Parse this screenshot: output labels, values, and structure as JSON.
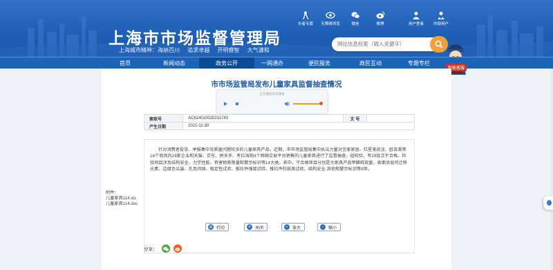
{
  "header": {
    "title": "上海市市场监督管理局",
    "spirit": [
      "上海城市精神：海纳百川",
      "追求卓越",
      "开明睿智",
      "大气谦和"
    ],
    "icons": [
      {
        "label": "长者专版",
        "icon": "elderly-icon"
      },
      {
        "label": "无障碍浏览",
        "icon": "accessibility-eye-icon"
      },
      {
        "label": "微信",
        "icon": "wechat-icon"
      },
      {
        "label": "微博",
        "icon": "weibo-icon"
      },
      {
        "label": "用户登录",
        "icon": "user-login-icon"
      },
      {
        "label": "内部用户",
        "icon": "internal-user-icon"
      }
    ],
    "search_placeholder": "网站信息检索（输入关键字）"
  },
  "nav": {
    "items": [
      "首页",
      "新闻动态",
      "政务公开",
      "一网通办",
      "便民服务",
      "政民互动",
      "专题专栏"
    ],
    "active": "政务公开",
    "consult_label": "智能客服"
  },
  "article": {
    "title": "市市场监管局发布儿童家具监督抽查情况",
    "player_label": "正在播放语音播报",
    "meta": {
      "index_label": "索取号",
      "index_value": "AC614010020211743",
      "doc_label": "文 号",
      "doc_value": "",
      "date_label": "产生日期",
      "date_value": "2021-11-30"
    },
    "body": "针对消费者投诉、举报集中及质量问题较多的儿童家具产品，近期，市市场监管局集中执法力量对宜家家居、红星美凯龙、欧亚美等16个商场内24家企业和天猫、京东、拼多多、考拉海购4个网络交易平台销售的儿童家具进行了监督抽查。经检验，有19批次不合格。检验项目涉及结构安全、力学性能、有害物质限量和警示标识等14大类。其中，不合格项目分别是大家具产品甲醛释放量、表面涂层可迁移元素、边缘及尖端、孔及间隙、稳定性试验、推拉件强度试验、推拉件防脱离试验、结构安全-其他和警示标识等8项。",
    "attachments_label": "附件：",
    "attachments": [
      "儿童家具114.xls",
      "儿童家具114.doc"
    ]
  },
  "actions": {
    "print": "打印",
    "close": "关闭",
    "zoom_in": "放大",
    "zoom_out": "缩小"
  },
  "share": {
    "label": "分享："
  },
  "colors": {
    "header_blue": "#1d5fb6",
    "nav_blue": "#1b64ba",
    "title_blue": "#1d5aa8",
    "search_orange": "#f0a23a"
  }
}
